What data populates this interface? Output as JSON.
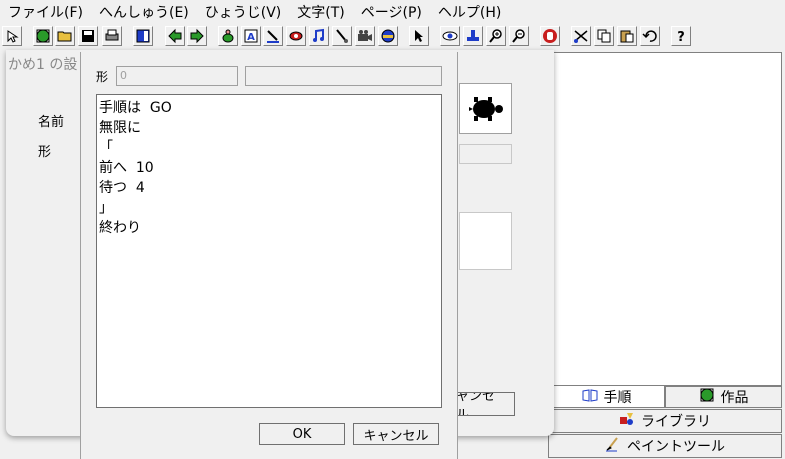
{
  "menu": [
    "ファイル(F)",
    "へんしゅう(E)",
    "ひょうじ(V)",
    "文字(T)",
    "ページ(P)",
    "ヘルプ(H)"
  ],
  "toolbar_icons": [
    "select-icon",
    "globe-icon",
    "open-folder-icon",
    "save-icon",
    "print-icon",
    "page-icon",
    "back-arrow-icon",
    "forward-arrow-icon",
    "turtle-icon",
    "text-icon",
    "pen-icon",
    "eye-red-icon",
    "music-icon",
    "brush-icon",
    "camera-icon",
    "hat-icon",
    "pointer-icon",
    "eye-icon",
    "stamp-icon",
    "zoom-in-icon",
    "zoom-out-icon",
    "stop-hand-icon",
    "cut-icon",
    "copy-icon",
    "paste-icon",
    "undo-icon",
    "help-icon"
  ],
  "background_window": {
    "title": "かめ1 の設",
    "name_label": "名前",
    "shape_label": "形",
    "cancel_label": "ャンセル"
  },
  "dialog": {
    "shape_label": "形",
    "shape_value": "0",
    "code_lines": [
      "手順は  GO",
      "無限に",
      "「",
      "前へ  10",
      "待つ  4",
      "」",
      "終わり"
    ],
    "ok_label": "OK",
    "cancel_label": "キャンセル"
  },
  "tabs": {
    "procedure": "手順",
    "works": "作品",
    "library": "ライブラリ",
    "paint_tool": "ペイントツール"
  },
  "colors": {
    "face": "#f0f0f0",
    "green": "#2a9a2a",
    "blue": "#1e3cc8",
    "red": "#c81e1e"
  }
}
